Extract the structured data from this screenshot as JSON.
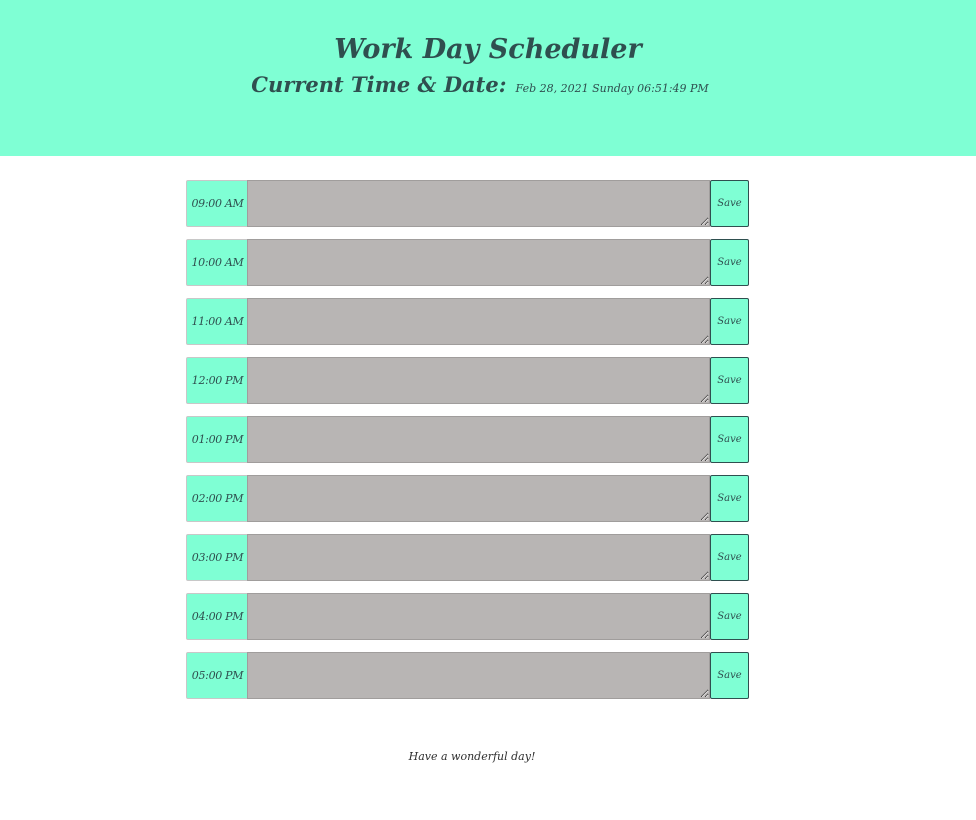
{
  "header": {
    "title": "Work Day Scheduler",
    "datetime_label": "Current Time & Date:",
    "datetime_value": "Feb 28, 2021 Sunday 06:51:49 PM"
  },
  "rows": [
    {
      "hour": "09:00 AM",
      "note": "",
      "save_label": "Save"
    },
    {
      "hour": "10:00 AM",
      "note": "",
      "save_label": "Save"
    },
    {
      "hour": "11:00 AM",
      "note": "",
      "save_label": "Save"
    },
    {
      "hour": "12:00 PM",
      "note": "",
      "save_label": "Save"
    },
    {
      "hour": "01:00 PM",
      "note": "",
      "save_label": "Save"
    },
    {
      "hour": "02:00 PM",
      "note": "",
      "save_label": "Save"
    },
    {
      "hour": "03:00 PM",
      "note": "",
      "save_label": "Save"
    },
    {
      "hour": "04:00 PM",
      "note": "",
      "save_label": "Save"
    },
    {
      "hour": "05:00 PM",
      "note": "",
      "save_label": "Save"
    }
  ],
  "footer": {
    "message": "Have a wonderful day!"
  },
  "colors": {
    "accent": "#7fffd4",
    "text": "#2f4f4f",
    "row_past": "#b8b5b4"
  }
}
